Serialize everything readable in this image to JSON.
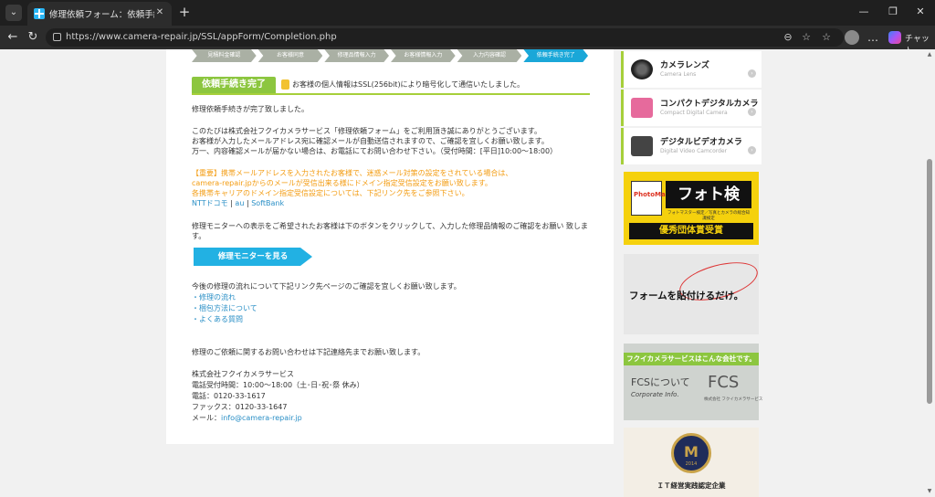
{
  "browser": {
    "tab_title": "修理依頼フォーム：依頼手続き完了",
    "url": "https://www.camera-repair.jp/SSL/appForm/Completion.php",
    "copilot_label": "チャット"
  },
  "steps": [
    "見積料金確認",
    "お客様同意",
    "修理品情報入力",
    "お客様情報入力",
    "入力内容確認",
    "依頼手続き完了"
  ],
  "section": {
    "label": "依頼手続き完了",
    "ssl_note": "お客様の個人情報はSSL(256bit)により暗号化して通信いたしました。"
  },
  "body": {
    "complete": "修理依頼手続きが完了致しました。",
    "thanks1": "このたびは株式会社フクイカメラサービス「修理依頼フォーム」をご利用頂き誠にありがとうございます。",
    "thanks2": "お客様が入力したメールアドレス宛に確認メールが自動送信されますので、ご確認を宜しくお願い致します。",
    "thanks3": "万一、内容確認メールが届かない場合は、お電話にてお問い合わせ下さい。（受付時間：[平日]10:00～18:00）",
    "important1": "【重要】携帯メールアドレスを入力されたお客様で、迷惑メール対策の設定をされている場合は、",
    "important2": "camera-repair.jpからのメールが受信出来る様にドメイン指定受信設定をお願い致します。",
    "important3": "各携帯キャリアのドメイン指定受信設定については、下記リンク先をご参照下さい。",
    "carriers": [
      "NTTドコモ",
      "au",
      "SoftBank"
    ],
    "carrier_sep": "|",
    "monitor1": "修理モニターへの表示をご希望されたお客様は下のボタンをクリックして、入力した修理品情報のご確認をお願い 致しま",
    "monitor2": "す。",
    "monitor_button": "修理モニターを見る",
    "flow_intro": "今後の修理の流れについて下記リンク先ページのご確認を宜しくお願い致します。",
    "flow_links": [
      "・修理の流れ",
      "・梱包方法について",
      "・よくある質問"
    ],
    "contact_intro": "修理のご依頼に関するお問い合わせは下記連絡先までお願い致します。",
    "company": "株式会社フクイカメラサービス",
    "hours": "電話受付時間：10:00～18:00（土･日･祝･祭 休み）",
    "phone": "電話：0120-33-1617",
    "fax": "ファックス：0120-33-1647",
    "mail_label": "メール：",
    "mail": "info@camera-repair.jp"
  },
  "sidebar": {
    "categories": [
      {
        "title": "カメラレンズ",
        "sub": "Camera Lens"
      },
      {
        "title": "コンパクトデジタルカメラ",
        "sub": "Compact Digital Camera"
      },
      {
        "title": "デジタルビデオカメラ",
        "sub": "Digital Video Camcorder"
      }
    ],
    "photo_logo": "PhotoMaster",
    "photo_title": "フォト検",
    "photo_tag": "フォトマスター検定／写真とカメラの総合知識検定",
    "photo_award": "優秀団体賞受賞",
    "paste": "フォームを貼付けるだけ。",
    "fcs_head": "フクイカメラサービスはこんな会社です。",
    "fcs_about": "FCSについて",
    "fcs_info": "Corporate Info.",
    "fcs_logo": "FCS",
    "fcs_sub": "株式会社 フクイカメラサービス",
    "it_year": "2014",
    "it_text": "ＩＴ経営実践認定企業"
  }
}
